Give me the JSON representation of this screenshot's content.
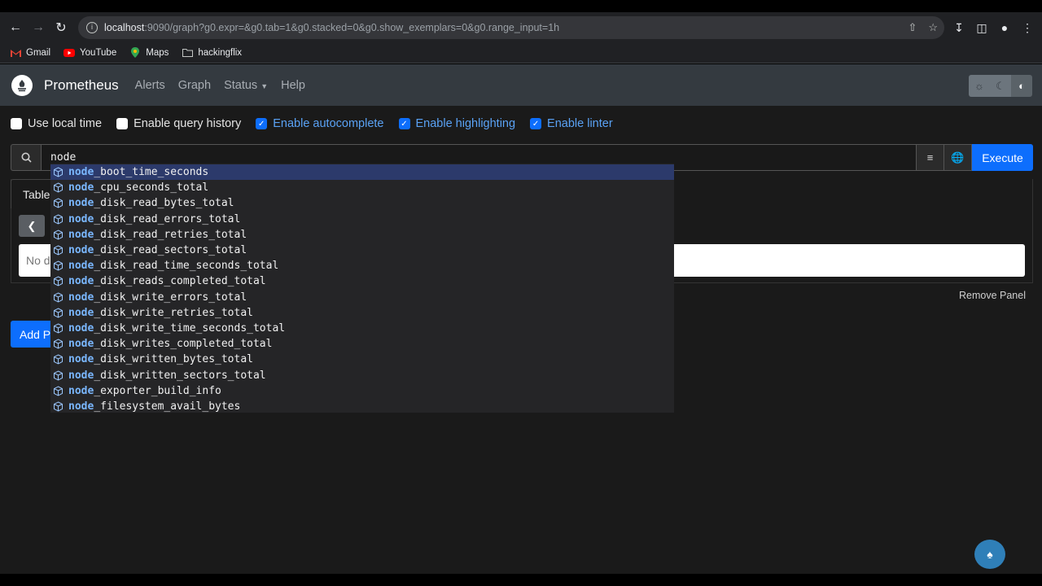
{
  "browser": {
    "url_host": "localhost",
    "url_rest": ":9090/graph?g0.expr=&g0.tab=1&g0.stacked=0&g0.show_exemplars=0&g0.range_input=1h",
    "bookmarks": [
      {
        "label": "Gmail",
        "icon": "gmail-icon"
      },
      {
        "label": "YouTube",
        "icon": "youtube-icon"
      },
      {
        "label": "Maps",
        "icon": "maps-icon"
      },
      {
        "label": "hackingflix",
        "icon": "folder-icon"
      }
    ]
  },
  "navbar": {
    "brand": "Prometheus",
    "links": [
      "Alerts",
      "Graph",
      "Status",
      "Help"
    ]
  },
  "options": {
    "use_local_time": {
      "label": "Use local time",
      "checked": false
    },
    "enable_query_history": {
      "label": "Enable query history",
      "checked": false
    },
    "enable_autocomplete": {
      "label": "Enable autocomplete",
      "checked": true
    },
    "enable_highlighting": {
      "label": "Enable highlighting",
      "checked": true
    },
    "enable_linter": {
      "label": "Enable linter",
      "checked": true
    }
  },
  "query": {
    "value": "node",
    "execute_label": "Execute"
  },
  "panel": {
    "tab_table": "Table",
    "no_data": "No d",
    "remove_label": "Remove Panel",
    "add_label": "Add P"
  },
  "autocomplete": {
    "match": "node",
    "items": [
      "_boot_time_seconds",
      "_cpu_seconds_total",
      "_disk_read_bytes_total",
      "_disk_read_errors_total",
      "_disk_read_retries_total",
      "_disk_read_sectors_total",
      "_disk_read_time_seconds_total",
      "_disk_reads_completed_total",
      "_disk_write_errors_total",
      "_disk_write_retries_total",
      "_disk_write_time_seconds_total",
      "_disk_writes_completed_total",
      "_disk_written_bytes_total",
      "_disk_written_sectors_total",
      "_exporter_build_info",
      "_filesystem_avail_bytes"
    ]
  }
}
